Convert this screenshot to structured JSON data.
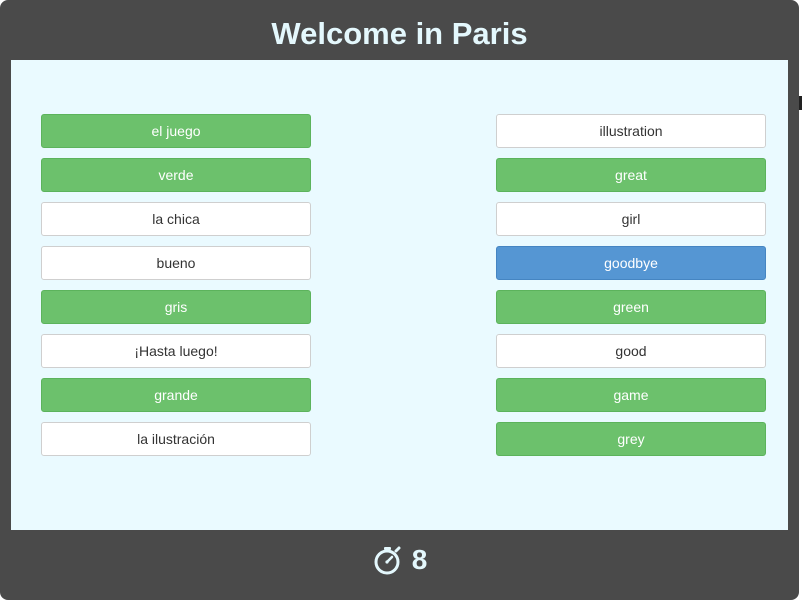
{
  "header": {
    "title": "Welcome in Paris"
  },
  "left_column": [
    {
      "label": "el juego",
      "state": "green"
    },
    {
      "label": "verde",
      "state": "green"
    },
    {
      "label": "la chica",
      "state": "white"
    },
    {
      "label": "bueno",
      "state": "white"
    },
    {
      "label": "gris",
      "state": "green"
    },
    {
      "label": "¡Hasta luego!",
      "state": "white"
    },
    {
      "label": "grande",
      "state": "green"
    },
    {
      "label": "la ilustración",
      "state": "white"
    }
  ],
  "right_column": [
    {
      "label": "illustration",
      "state": "white"
    },
    {
      "label": "great",
      "state": "green"
    },
    {
      "label": "girl",
      "state": "white"
    },
    {
      "label": "goodbye",
      "state": "blue"
    },
    {
      "label": "green",
      "state": "green"
    },
    {
      "label": "good",
      "state": "white"
    },
    {
      "label": "game",
      "state": "green"
    },
    {
      "label": "grey",
      "state": "green"
    }
  ],
  "footer": {
    "timer_icon": "stopwatch-icon",
    "timer_value": "8"
  },
  "colors": {
    "frame": "#4a4a4a",
    "board": "#eafaff",
    "matched": "#6cc16c",
    "selected": "#5596d3",
    "unmatched": "#ffffff",
    "header_text": "#e4f8fd"
  }
}
